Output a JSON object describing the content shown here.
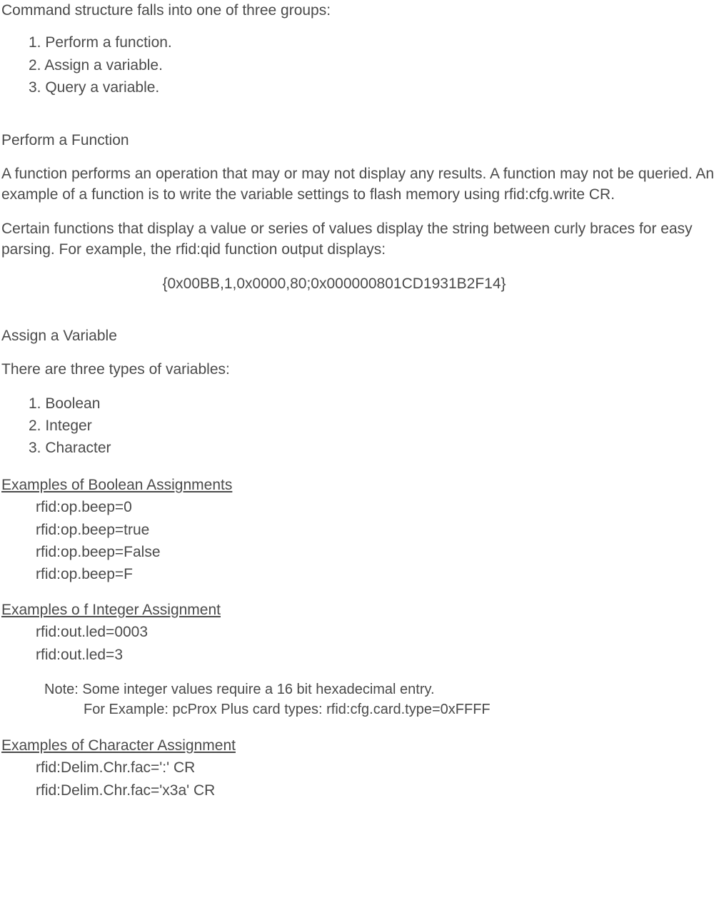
{
  "doc": {
    "intro": "Command structure falls into one of three groups:",
    "groups": {
      "item1": "1. Perform a function.",
      "item2": "2. Assign a variable.",
      "item3": "3. Query a variable."
    },
    "perform": {
      "heading": "Perform a Function",
      "para1": "A function performs an operation that may or may not display any results. A function may not be queried. An example of a function is to write the variable settings to flash memory using rfid:cfg.write  CR.",
      "para2": "Certain functions that display a value or series of values display the string between curly braces for easy parsing. For example, the rfid:qid function output displays:",
      "code": "{0x00BB,1,0x0000,80;0x000000801CD1931B2F14}"
    },
    "assign": {
      "heading": "Assign a Variable",
      "intro": "There are three types of variables:",
      "types": {
        "item1": "1. Boolean",
        "item2": "2. Integer",
        "item3": "3. Character"
      },
      "boolean": {
        "heading": "Examples of Boolean Assignments",
        "ex1": "rfid:op.beep=0",
        "ex2": "rfid:op.beep=true",
        "ex3": "rfid:op.beep=False",
        "ex4": "rfid:op.beep=F"
      },
      "integer": {
        "heading": "Examples o f Integer Assignment",
        "ex1": "rfid:out.led=0003",
        "ex2": "rfid:out.led=3",
        "note1": "Note: Some integer values require a 16 bit hexadecimal entry.",
        "note2": "For Example: pcProx Plus card types: rfid:cfg.card.type=0xFFFF"
      },
      "character": {
        "heading": "Examples of Character Assignment",
        "ex1": "rfid:Delim.Chr.fac=':' CR",
        "ex2": "rfid:Delim.Chr.fac='x3a' CR"
      }
    }
  }
}
